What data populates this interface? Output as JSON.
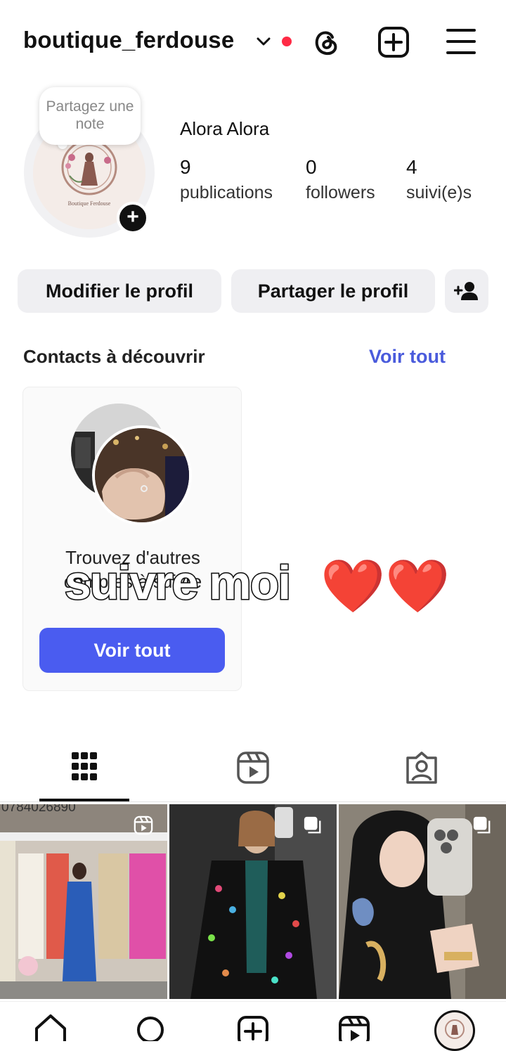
{
  "header": {
    "username": "boutique_ferdouse"
  },
  "profile": {
    "note_placeholder": "Partagez une note",
    "display_name": "Alora Alora",
    "avatar_logo_text": "Boutique Ferdouse",
    "stats": [
      {
        "value": "9",
        "label": "publications"
      },
      {
        "value": "0",
        "label": "followers"
      },
      {
        "value": "4",
        "label": "suivi(e)s"
      }
    ]
  },
  "actions": {
    "edit_label": "Modifier le profil",
    "share_label": "Partager le profil"
  },
  "discover": {
    "title": "Contacts à découvrir",
    "see_all": "Voir tout",
    "card_text": "Trouvez d'autres comptes à suivre",
    "card_button": "Voir tout"
  },
  "overlay": {
    "caption": "suivre moi",
    "emoji": "❤️❤️"
  },
  "tabs": [
    {
      "icon": "grid-icon",
      "active": true
    },
    {
      "icon": "reels-icon",
      "active": false
    },
    {
      "icon": "tagged-icon",
      "active": false
    }
  ],
  "posts": [
    {
      "caption_overlay": "0784026890",
      "badge": "reel-icon"
    },
    {
      "badge": "carousel-icon"
    },
    {
      "badge": "carousel-icon"
    }
  ],
  "bottom_nav": [
    "home-icon",
    "search-icon",
    "create-icon",
    "reels-icon",
    "profile-avatar"
  ],
  "colors": {
    "accent": "#4a5cf0",
    "link": "#4a5bdc",
    "notification": "#ff2a45"
  }
}
